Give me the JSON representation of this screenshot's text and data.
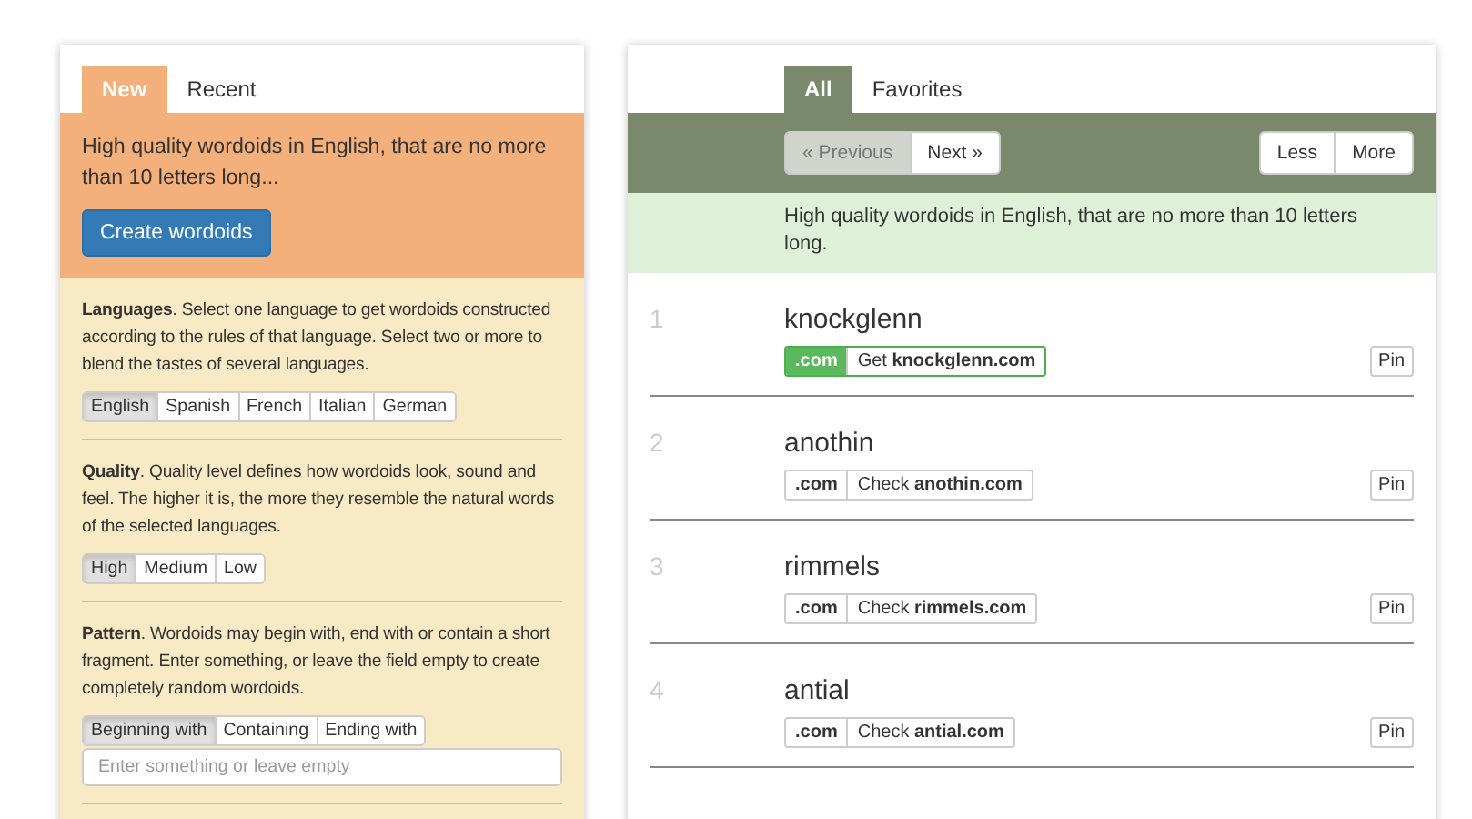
{
  "left_tabs": [
    {
      "label": "New",
      "selected": true
    },
    {
      "label": "Recent",
      "selected": false
    }
  ],
  "summary": "High quality wordoids in English, that are no more than 10 letters long...",
  "create_button": "Create wordoids",
  "sections": [
    {
      "text": "**Languages**. Select one language to get wordoids constructed according to the rules of that language. Select two or more to blend the tastes of several languages.",
      "options": [
        {
          "label": "English",
          "selected": true
        },
        {
          "label": "Spanish",
          "selected": false
        },
        {
          "label": "French",
          "selected": false
        },
        {
          "label": "Italian",
          "selected": false
        },
        {
          "label": "German",
          "selected": false
        }
      ]
    },
    {
      "text": "**Quality**. Quality level defines how wordoids look, sound and feel. The higher it is, the more they resemble the natural words of the selected languages.",
      "options": [
        {
          "label": "High",
          "selected": true
        },
        {
          "label": "Medium",
          "selected": false
        },
        {
          "label": "Low",
          "selected": false
        }
      ]
    },
    {
      "text": "**Pattern**. Wordoids may begin with, end with or contain a short fragment. Enter something, or leave the field empty to create completely random wordoids.",
      "options": [
        {
          "label": "Beginning with",
          "selected": true
        },
        {
          "label": "Containing",
          "selected": false
        },
        {
          "label": "Ending with",
          "selected": false
        }
      ],
      "placeholder": "Enter something or leave empty"
    }
  ],
  "right_tabs": [
    {
      "label": "All",
      "selected": true
    },
    {
      "label": "Favorites",
      "selected": false
    }
  ],
  "pager": [
    {
      "label": "« Previous",
      "disabled": true
    },
    {
      "label": "Next »",
      "disabled": false
    }
  ],
  "amount": [
    "Less",
    "More"
  ],
  "info": "High quality wordoids in English, that are no more than 10 letters long.",
  "results": [
    {
      "number": "1",
      "word": "knockglenn",
      "tld": ".com",
      "link": "Get **knockglenn.com**",
      "available": true,
      "pin": "Pin"
    },
    {
      "number": "2",
      "word": "anothin",
      "tld": ".com",
      "link": "Check **anothin.com**",
      "available": false,
      "pin": "Pin"
    },
    {
      "number": "3",
      "word": "rimmels",
      "tld": ".com",
      "link": "Check **rimmels.com**",
      "available": false,
      "pin": "Pin"
    },
    {
      "number": "4",
      "word": "antial",
      "tld": ".com",
      "link": "Check **antial.com**",
      "available": false,
      "pin": "Pin"
    }
  ]
}
